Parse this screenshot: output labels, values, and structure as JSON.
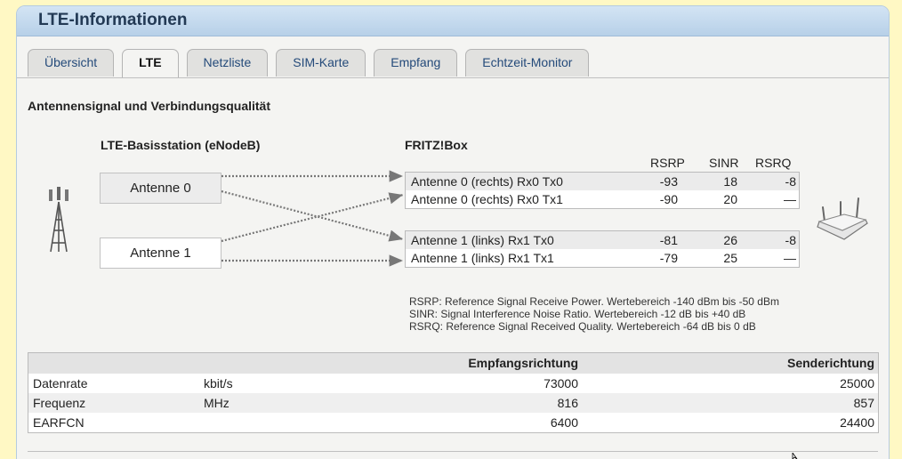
{
  "panel": {
    "title": "LTE-Informationen"
  },
  "tabs": [
    {
      "label": "Übersicht"
    },
    {
      "label": "LTE"
    },
    {
      "label": "Netzliste"
    },
    {
      "label": "SIM-Karte"
    },
    {
      "label": "Empfang"
    },
    {
      "label": "Echtzeit-Monitor"
    }
  ],
  "active_tab": "LTE",
  "section": {
    "title": "Antennensignal und Verbindungsqualität",
    "basestation_label": "LTE-Basisstation (eNodeB)",
    "fritzbox_label": "FRITZ!Box",
    "columns": [
      "RSRP",
      "SINR",
      "RSRQ"
    ],
    "antennas": [
      "Antenne 0",
      "Antenne 1"
    ],
    "rx_rows": [
      {
        "name": "Antenne 0 (rechts) Rx0 Tx0",
        "rsrp": "-93",
        "sinr": "18",
        "rsrq": "-8"
      },
      {
        "name": "Antenne 0 (rechts) Rx0 Tx1",
        "rsrp": "-90",
        "sinr": "20",
        "rsrq": "—"
      },
      {
        "name": "Antenne 1 (links) Rx1 Tx0",
        "rsrp": "-81",
        "sinr": "26",
        "rsrq": "-8"
      },
      {
        "name": "Antenne 1 (links) Rx1 Tx1",
        "rsrp": "-79",
        "sinr": "25",
        "rsrq": "—"
      }
    ],
    "legend": [
      "RSRP: Reference Signal Receive Power. Wertebereich -140 dBm bis -50 dBm",
      "SINR: Signal Interference Noise Ratio. Wertebereich -12 dB bis +40 dB",
      "RSRQ: Reference Signal Received Quality. Wertebereich -64 dB bis 0 dB"
    ]
  },
  "data_table": {
    "headers": {
      "receive": "Empfangsrichtung",
      "send": "Senderichtung"
    },
    "rows": [
      {
        "name": "Datenrate",
        "unit": "kbit/s",
        "receive": "73000",
        "send": "25000"
      },
      {
        "name": "Frequenz",
        "unit": "MHz",
        "receive": "816",
        "send": "857"
      },
      {
        "name": "EARFCN",
        "unit": "",
        "receive": "6400",
        "send": "24400"
      }
    ]
  },
  "icons": {
    "tower": "cell-tower-icon",
    "router": "router-icon"
  },
  "colors": {
    "header_bg": "#c5dbef",
    "page_bg": "#fff8c4",
    "title_text": "#233a55"
  }
}
